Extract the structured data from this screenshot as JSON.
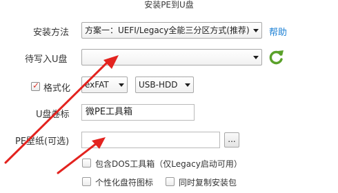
{
  "window": {
    "title": "安装PE到U盘"
  },
  "form": {
    "method_label": "安装方法",
    "method_value": "方案一：UEFI/Legacy全能三分区方式(推荐)",
    "help_label": "帮助",
    "target_label": "待写入U盘",
    "target_value": "",
    "format_label": "格式化",
    "format_checked": true,
    "fs_value": "exFAT",
    "mode_value": "USB-HDD",
    "volume_label": "U盘卷标",
    "volume_value": "微PE工具箱",
    "wallpaper_label": "PE壁纸(可选)",
    "wallpaper_value": "",
    "browse_label": "...",
    "opt_dos_label": "包含DOS工具箱（仅Legacy启动可用）",
    "opt_icon_label": "个性化盘符图标",
    "opt_copy_label": "同时复制安装包"
  },
  "icons": {
    "refresh": "refresh-icon",
    "checkmark": "checkmark-icon",
    "dropdown": "chevron-down-icon",
    "annotation": "red-arrow-annotation"
  },
  "colors": {
    "link": "#1a7fd4",
    "refresh_green": "#5aa12a",
    "annotation_red": "#e3231f",
    "check_red": "#d9362b"
  }
}
